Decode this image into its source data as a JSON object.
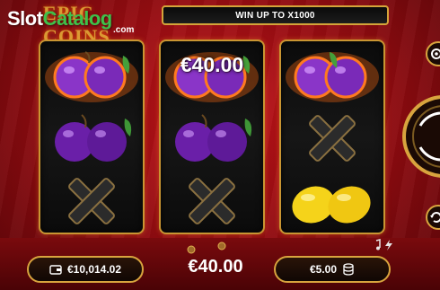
{
  "watermark": {
    "brand_a": "Slot",
    "brand_b": "Catalog",
    "suffix": ".com"
  },
  "game": {
    "logo_text": "EPIC COINS"
  },
  "banner": {
    "text": "WIN UP TO X1000"
  },
  "reels": [
    {
      "symbols": [
        "burning-plums",
        "plums",
        "x-symbol"
      ],
      "value": ""
    },
    {
      "symbols": [
        "burning-plums",
        "plums",
        "x-symbol"
      ],
      "value": "€40.00"
    },
    {
      "symbols": [
        "burning-plums",
        "x-symbol",
        "lemons"
      ],
      "value": ""
    }
  ],
  "footer": {
    "balance": "€10,014.02",
    "win": "€40.00",
    "bet": "€5.00"
  },
  "icons": {
    "balance": "wallet-icon",
    "bet": "coin-stack-icon",
    "sound": "music-note-icon",
    "turbo": "lightning-icon",
    "settings": "gear-icon",
    "spin": "spin-icon",
    "autoplay": "autoplay-icon"
  },
  "colors": {
    "background": "#a80f15",
    "frame_gold": "#c99532",
    "plum": "#7a2ab8",
    "lemon": "#f5d31a",
    "x_symbol": "#2b2b2b"
  }
}
